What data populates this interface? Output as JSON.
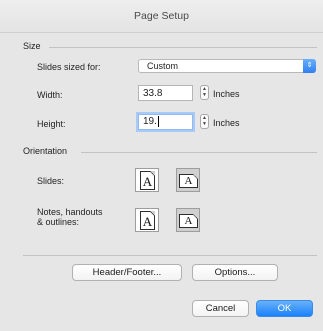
{
  "window": {
    "title": "Page Setup"
  },
  "size": {
    "section_label": "Size",
    "slides_sized_for_label": "Slides sized for:",
    "slides_sized_for_value": "Custom",
    "width_label": "Width:",
    "width_value": "33.8",
    "width_unit": "Inches",
    "height_label": "Height:",
    "height_value": "19.",
    "height_unit": "Inches"
  },
  "orientation": {
    "section_label": "Orientation",
    "slides_label": "Slides:",
    "notes_label_line1": "Notes, handouts",
    "notes_label_line2": "& outlines:",
    "icon_letter": "A"
  },
  "buttons": {
    "header_footer": "Header/Footer...",
    "options": "Options...",
    "cancel": "Cancel",
    "ok": "OK"
  }
}
